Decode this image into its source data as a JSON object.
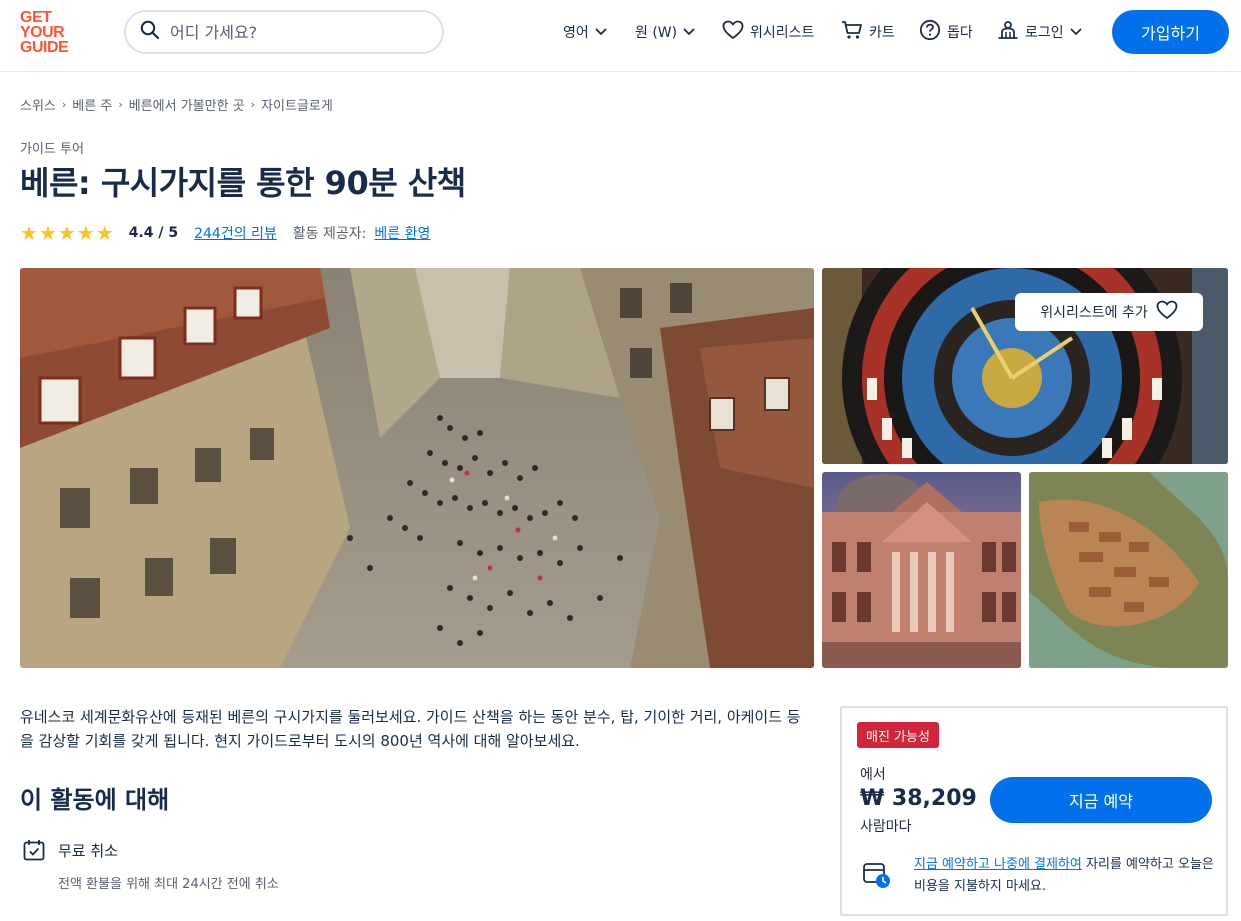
{
  "header": {
    "logo_lines": [
      "GET",
      "YOUR",
      "GUIDE"
    ],
    "search_placeholder": "어디 가세요?",
    "language_label": "영어",
    "currency_label": "원 (W)",
    "wishlist_label": "위시리스트",
    "cart_label": "카트",
    "help_label": "돕다",
    "login_label": "로그인",
    "signup_label": "가입하기"
  },
  "breadcrumb": [
    "스위스",
    "베른 주",
    "베른에서 가볼만한 곳",
    "자이트글로게"
  ],
  "category": "가이드 투어",
  "title": "베른: 구시가지를 통한 90분 산책",
  "rating": {
    "stars": 5,
    "score_text": "4.4 / 5",
    "reviews_text": "244건의 리뷰",
    "provider_label": "활동 제공자:",
    "provider_name": "베른 환영"
  },
  "gallery": {
    "wishlist_button_label": "위시리스트에 추가"
  },
  "description": "유네스코 세계문화유산에 등재된 베른의 구시가지를 둘러보세요. 가이드 산책을 하는 동안 분수, 탑, 기이한 거리, 아케이드 등을 감상할 기회를 갖게 됩니다. 현지 가이드로부터 도시의 800년 역사에 대해 알아보세요.",
  "about": {
    "title": "이 활동에 대해",
    "features": [
      {
        "title": "무료 취소",
        "desc": "전액 환불을 위해 최대 24시간 전에 취소"
      }
    ]
  },
  "booking": {
    "badge": "매진 가능성",
    "from_label": "에서",
    "price": "₩ 38,209",
    "per_label": "사람마다",
    "book_button": "지금 예약",
    "reserve_link": "지금 예약하고 나중에 결제하여",
    "reserve_text": " 자리를 예약하고 오늘은 비용을 지불하지 마세요."
  },
  "colors": {
    "brand": "#ff5533",
    "primary": "#0071eb",
    "badge": "#d2253a",
    "star": "#fdc41f",
    "text": "#1a2b49"
  }
}
